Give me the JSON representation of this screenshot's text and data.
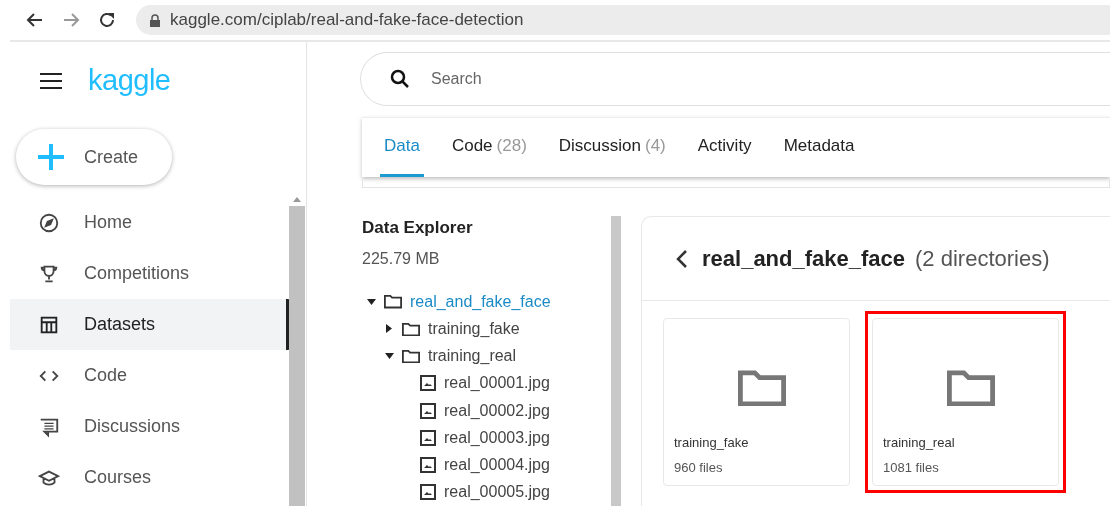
{
  "browser": {
    "url": "kaggle.com/ciplab/real-and-fake-face-detection"
  },
  "sidebar": {
    "logo": "kaggle",
    "create_button": "Create",
    "items": [
      {
        "label": "Home",
        "kind": "compass",
        "selected": false
      },
      {
        "label": "Competitions",
        "kind": "trophy",
        "selected": false
      },
      {
        "label": "Datasets",
        "kind": "table",
        "selected": true
      },
      {
        "label": "Code",
        "kind": "code",
        "selected": false
      },
      {
        "label": "Discussions",
        "kind": "comment",
        "selected": false
      },
      {
        "label": "Courses",
        "kind": "school",
        "selected": false
      }
    ]
  },
  "search": {
    "placeholder": "Search"
  },
  "tabs": [
    {
      "label": "Data",
      "selected": true
    },
    {
      "label": "Code",
      "count": "(28)",
      "selected": false
    },
    {
      "label": "Discussion",
      "count": "(4)",
      "selected": false
    },
    {
      "label": "Activity",
      "selected": false
    },
    {
      "label": "Metadata",
      "selected": false
    }
  ],
  "data_explorer": {
    "title": "Data Explorer",
    "size": "225.79 MB",
    "tree": [
      {
        "name": "real_and_fake_face",
        "kind": "folder",
        "expanded": true,
        "selected": true,
        "children": [
          {
            "name": "training_fake",
            "kind": "folder",
            "expanded": false,
            "selected": false
          },
          {
            "name": "training_real",
            "kind": "folder",
            "expanded": true,
            "selected": false,
            "children": [
              {
                "name": "real_00001.jpg",
                "kind": "file",
                "selected": false
              },
              {
                "name": "real_00002.jpg",
                "kind": "file",
                "selected": false
              },
              {
                "name": "real_00003.jpg",
                "kind": "file",
                "selected": false
              },
              {
                "name": "real_00004.jpg",
                "kind": "file",
                "selected": false
              },
              {
                "name": "real_00005.jpg",
                "kind": "file",
                "selected": false
              }
            ]
          }
        ]
      }
    ]
  },
  "directory": {
    "title": "real_and_fake_face",
    "summary": "(2 directories)",
    "folders": [
      {
        "name": "training_fake",
        "files": "960 files",
        "highlighted": false
      },
      {
        "name": "training_real",
        "files": "1081 files",
        "highlighted": true
      }
    ]
  }
}
